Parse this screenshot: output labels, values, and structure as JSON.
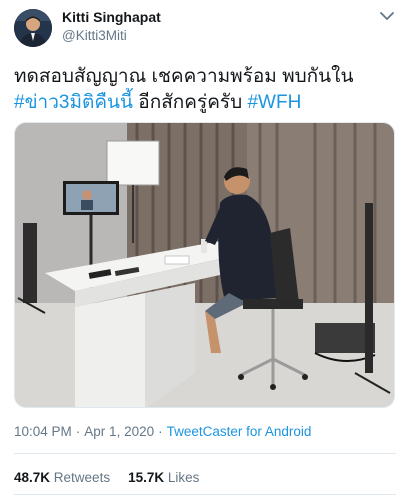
{
  "author": {
    "display_name": "Kitti Singhapat",
    "handle": "@Kitti3Miti",
    "avatar_icon": "profile-photo"
  },
  "menu_icon": "chevron-down-icon",
  "tweet": {
    "text_line1": "ทดสอบสัญญาณ เชคความพร้อม พบกันใน",
    "hashtag1": "#ข่าว3มิติคืนนี้",
    "text_mid": " อีกสักครู่ครับ ",
    "hashtag2": "#WFH"
  },
  "meta": {
    "time": "10:04 PM",
    "separator": "·",
    "date": "Apr 1, 2020",
    "source": "TweetCaster for Android"
  },
  "stats": {
    "retweets_count": "48.7K",
    "retweets_label": "Retweets",
    "likes_count": "15.7K",
    "likes_label": "Likes"
  },
  "colors": {
    "link": "#1b95e0",
    "secondary_text": "#657786",
    "divider": "#e1e8ed"
  }
}
